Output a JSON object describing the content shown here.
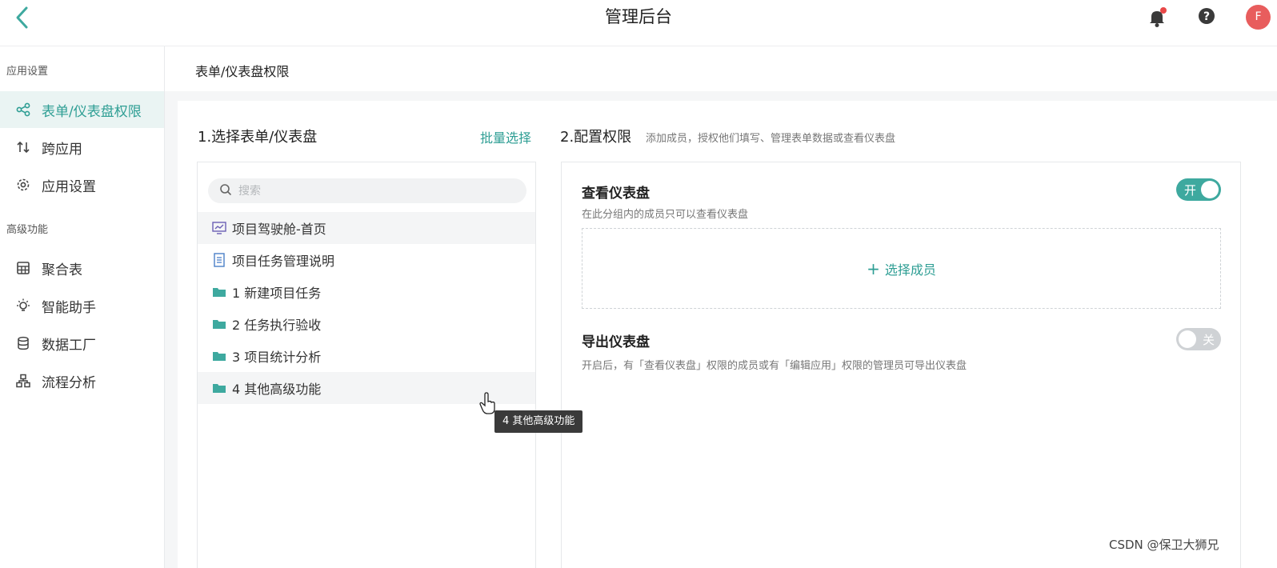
{
  "header": {
    "title": "管理后台",
    "avatar_letter": "F",
    "notification_dot_color": "#e84848"
  },
  "breadcrumb": "表单/仪表盘权限",
  "sidebar": {
    "groups": [
      "应用设置",
      "高级功能"
    ],
    "items": [
      {
        "label": "表单/仪表盘权限",
        "icon": "share-icon",
        "active": true
      },
      {
        "label": "跨应用",
        "icon": "cross-app-icon"
      },
      {
        "label": "应用设置",
        "icon": "gear-icon"
      },
      {
        "label": "聚合表",
        "icon": "table-icon"
      },
      {
        "label": "智能助手",
        "icon": "bulb-icon"
      },
      {
        "label": "数据工厂",
        "icon": "database-icon"
      },
      {
        "label": "流程分析",
        "icon": "flow-icon"
      }
    ]
  },
  "section1": {
    "title": "1.选择表单/仪表盘",
    "batch_label": "批量选择",
    "search_placeholder": "搜索"
  },
  "list": [
    {
      "label": "项目驾驶舱-首页",
      "icon": "dashboard-icon"
    },
    {
      "label": "项目任务管理说明",
      "icon": "document-icon"
    },
    {
      "label": "1 新建项目任务",
      "icon": "folder-icon"
    },
    {
      "label": "2 任务执行验收",
      "icon": "folder-icon"
    },
    {
      "label": "3 项目统计分析",
      "icon": "folder-icon"
    },
    {
      "label": "4 其他高级功能",
      "icon": "folder-icon"
    }
  ],
  "section2": {
    "title": "2.配置权限",
    "desc": "添加成员，授权他们填写、管理表单数据或查看仪表盘"
  },
  "view_perm": {
    "title": "查看仪表盘",
    "desc": "在此分组内的成员只可以查看仪表盘",
    "toggle_label": "开",
    "toggle_on": true,
    "select_label": "选择成员"
  },
  "export_perm": {
    "title": "导出仪表盘",
    "desc": "开启后，有「查看仪表盘」权限的成员或有「编辑应用」权限的管理员可导出仪表盘",
    "toggle_label": "关",
    "toggle_on": false
  },
  "tooltip": "4 其他高级功能",
  "watermark": "CSDN @保卫大狮兄",
  "accent_color": "#2e9e94"
}
